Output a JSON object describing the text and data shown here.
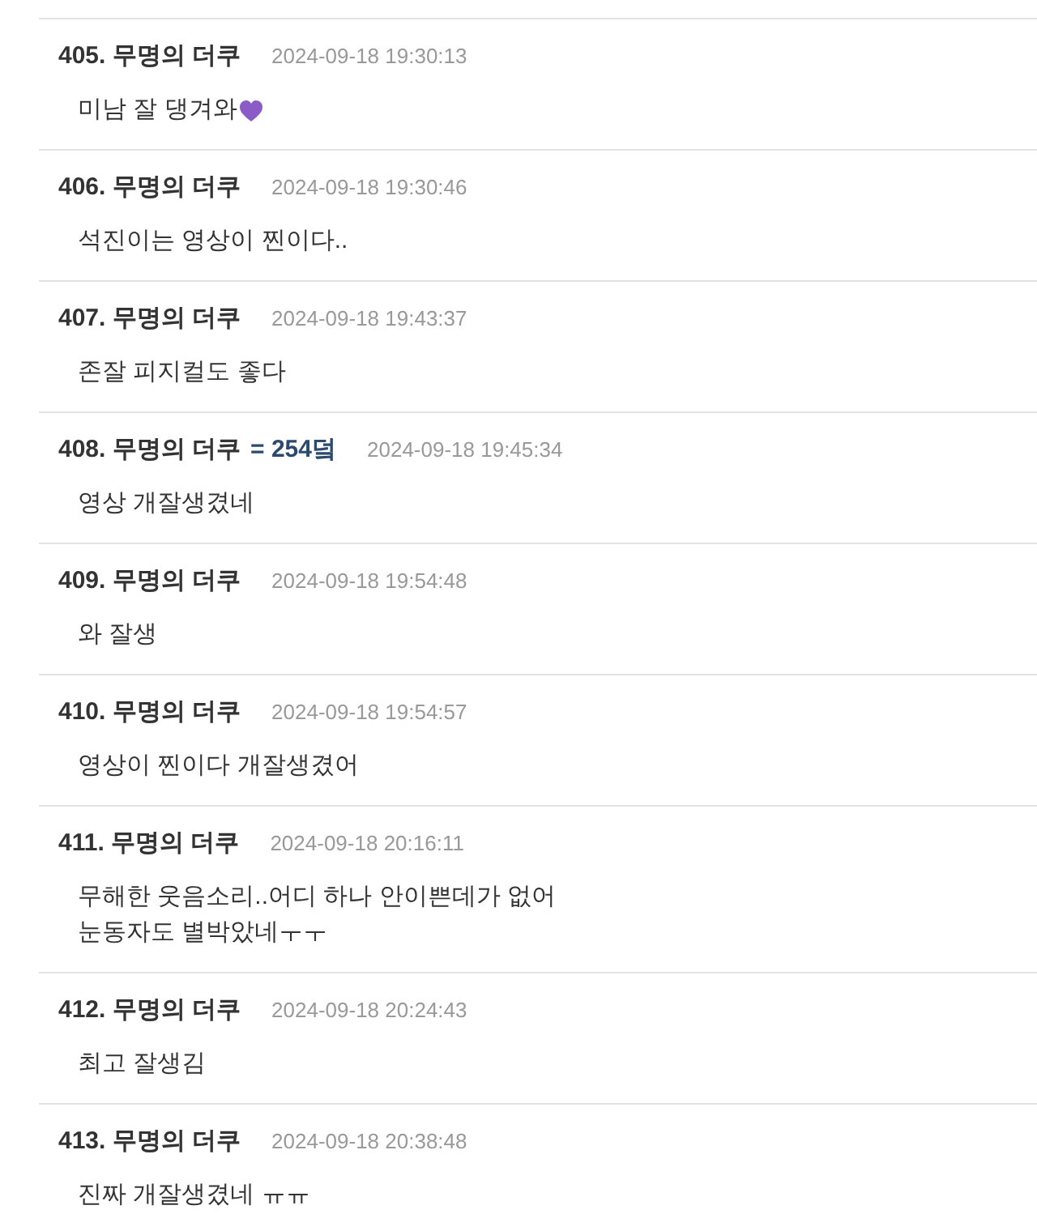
{
  "comments": [
    {
      "number": "405.",
      "author": "무명의 더쿠",
      "time": "2024-09-18 19:30:13",
      "body": "미남 잘 댕겨와",
      "heart_icon": true
    },
    {
      "number": "406.",
      "author": "무명의 더쿠",
      "time": "2024-09-18 19:30:46",
      "body": "석진이는 영상이 찐이다.."
    },
    {
      "number": "407.",
      "author": "무명의 더쿠",
      "time": "2024-09-18 19:43:37",
      "body": "존잘 피지컬도 좋다"
    },
    {
      "number": "408.",
      "author": "무명의 더쿠",
      "badge": "= 254덬",
      "time": "2024-09-18 19:45:34",
      "body": "영상 개잘생겼네"
    },
    {
      "number": "409.",
      "author": "무명의 더쿠",
      "time": "2024-09-18 19:54:48",
      "body": "와 잘생"
    },
    {
      "number": "410.",
      "author": "무명의 더쿠",
      "time": "2024-09-18 19:54:57",
      "body": "영상이 찐이다 개잘생겼어"
    },
    {
      "number": "411.",
      "author": "무명의 더쿠",
      "time": "2024-09-18 20:16:11",
      "body": "무해한 웃음소리..어디 하나 안이쁜데가 없어\n눈동자도 별박았네ㅜㅜ"
    },
    {
      "number": "412.",
      "author": "무명의 더쿠",
      "time": "2024-09-18 20:24:43",
      "body": "최고 잘생김"
    },
    {
      "number": "413.",
      "author": "무명의 더쿠",
      "time": "2024-09-18 20:38:48",
      "body": "진짜 개잘생겼네 ㅠㅠ"
    }
  ]
}
